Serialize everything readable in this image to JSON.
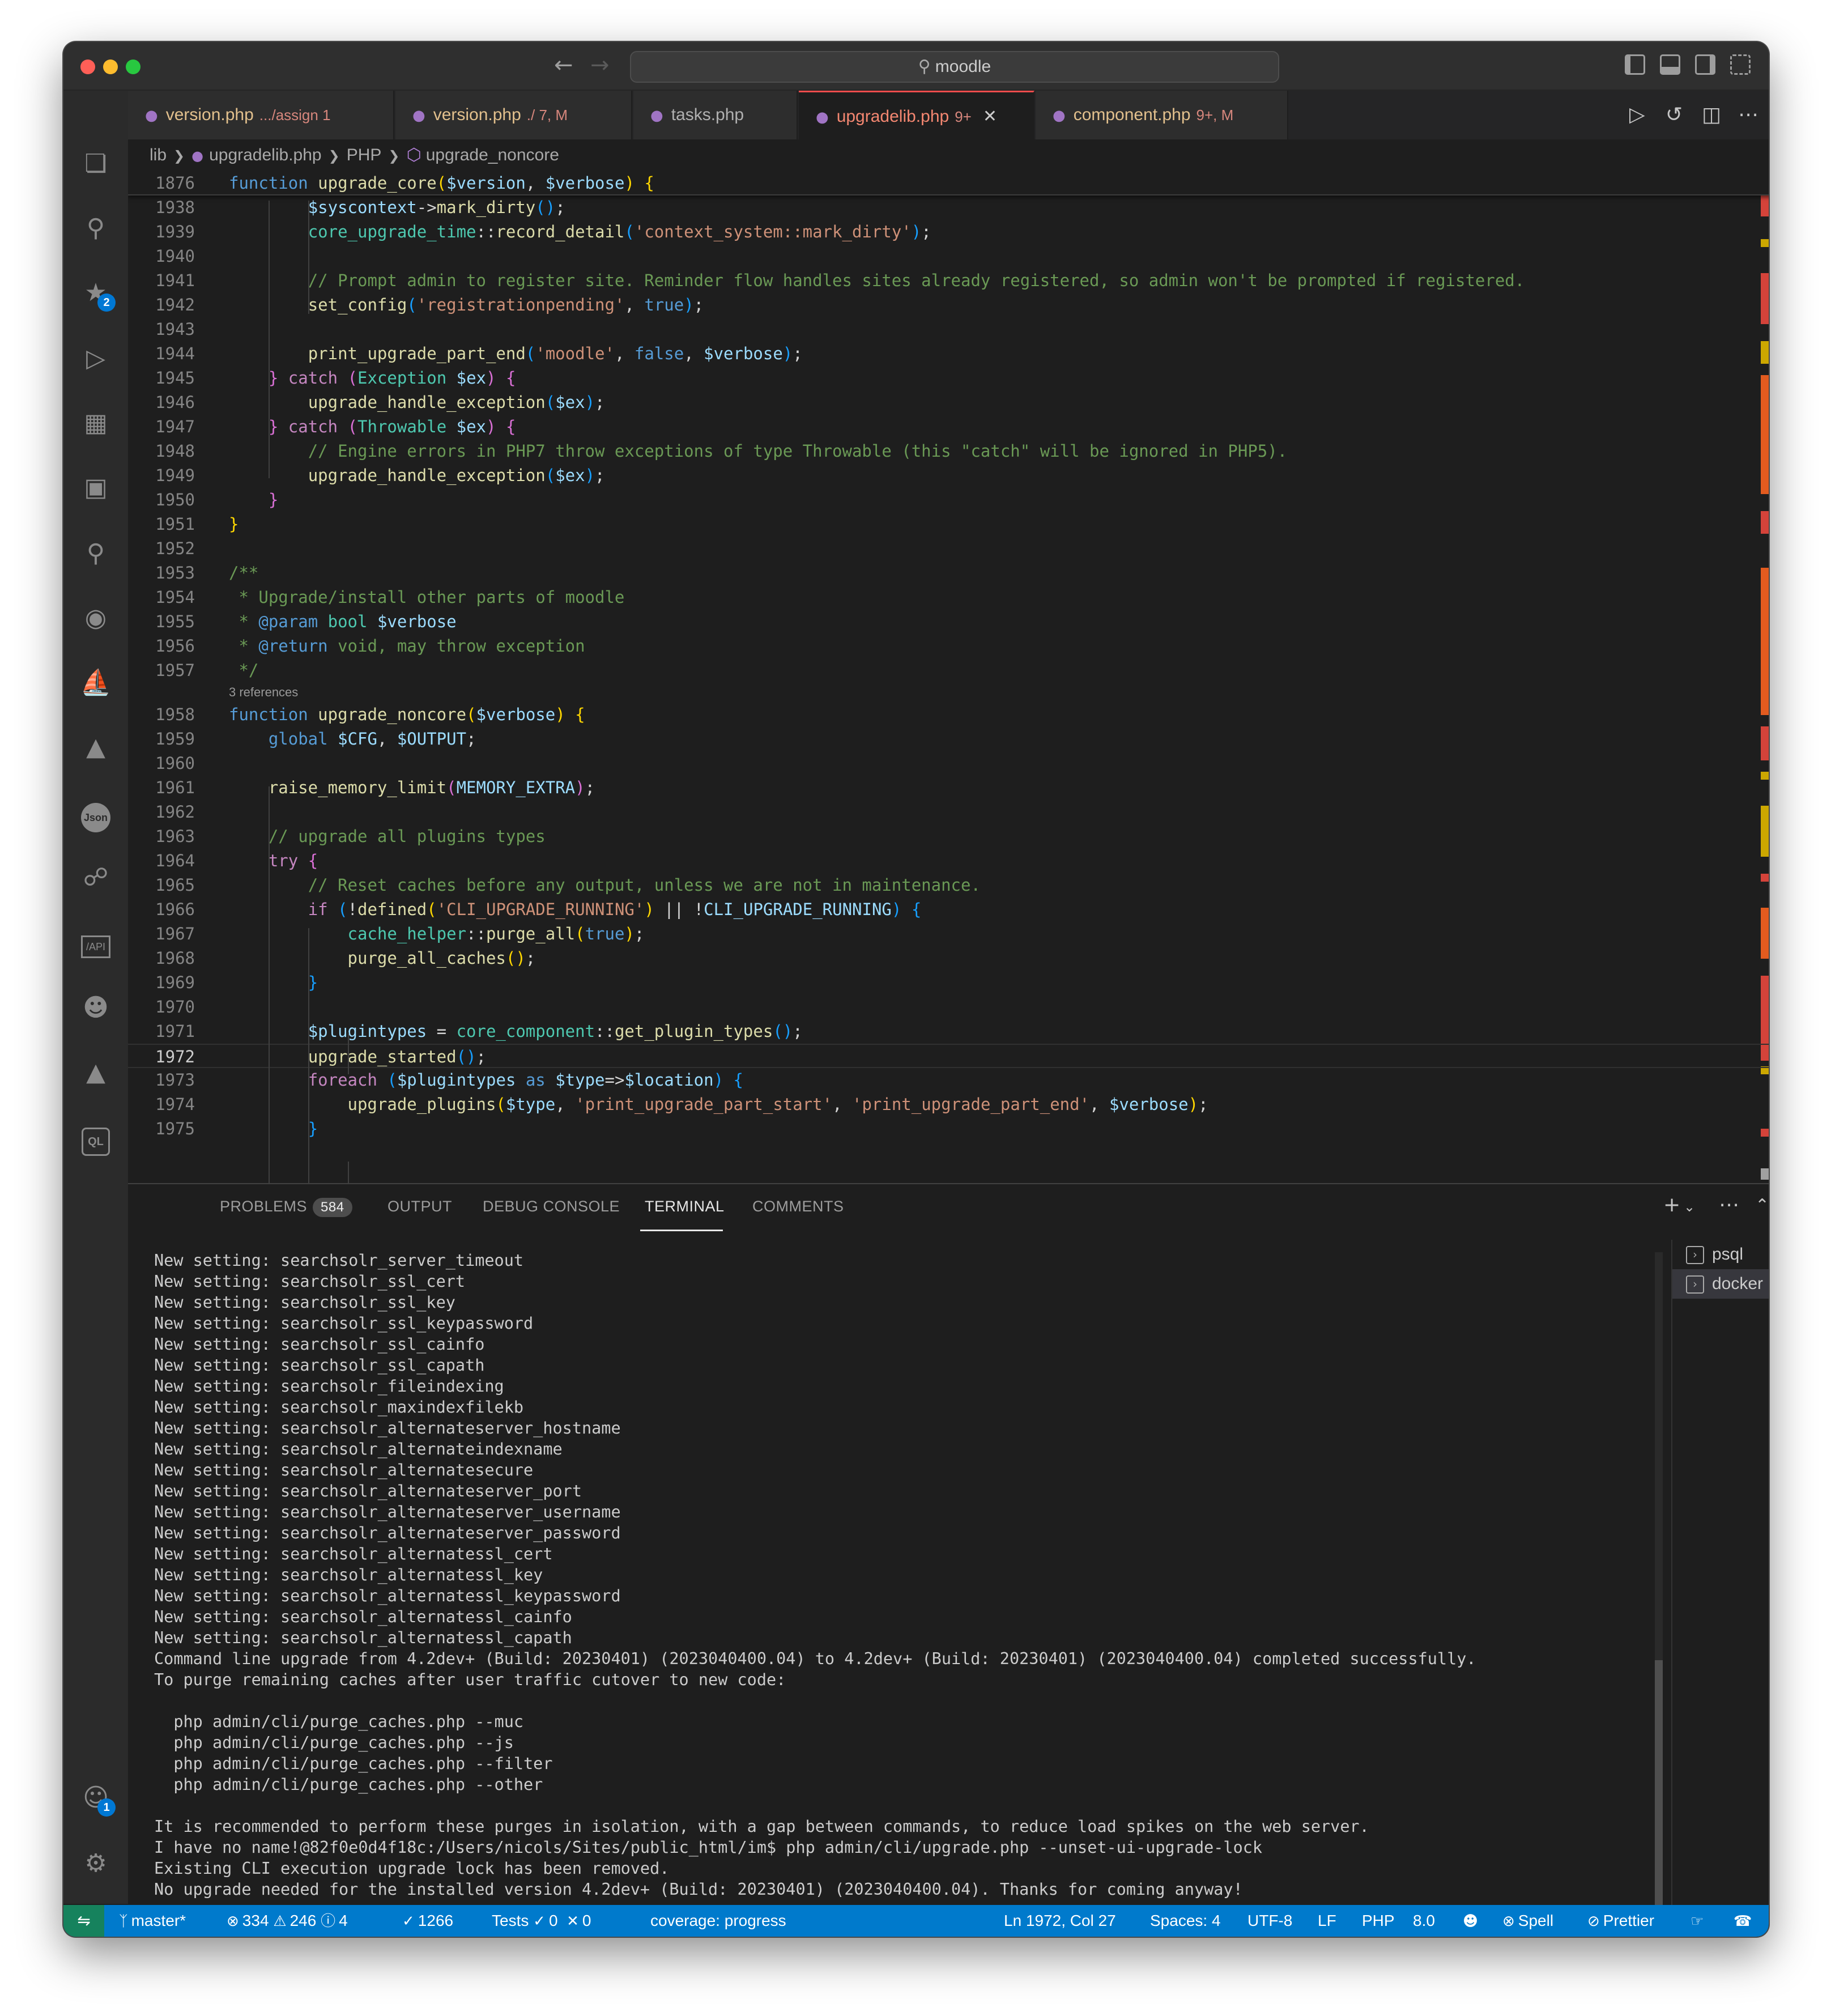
{
  "window": {
    "search_text": "moodle",
    "back_icon": "arrow-left-icon",
    "forward_icon": "arrow-right-icon"
  },
  "activity_bar": {
    "scm_badge": "2",
    "accounts_badge": "1",
    "icons": [
      "explorer-icon",
      "search-icon",
      "source-control-icon",
      "run-debug-icon",
      "extensions-icon",
      "remote-explorer-icon",
      "testing-icon",
      "github-icon",
      "docker-icon",
      "tree-icon",
      "json-icon",
      "database-icon",
      "api-icon",
      "copilot-icon",
      "azure-icon",
      "sql-icon",
      "accounts-icon",
      "settings-icon"
    ],
    "json_label": "Json",
    "api_label": "/API",
    "ql_label": "QL"
  },
  "tabs": [
    {
      "name": "version.php",
      "desc": ".../assign 1",
      "active": false,
      "modified": true
    },
    {
      "name": "version.php",
      "desc": "./ 7, M",
      "active": false,
      "modified": true
    },
    {
      "name": "tasks.php",
      "desc": "",
      "active": false,
      "modified": false
    },
    {
      "name": "upgradelib.php",
      "desc": "9+",
      "active": true,
      "modified": true
    },
    {
      "name": "component.php",
      "desc": "9+, M",
      "active": false,
      "modified": true
    }
  ],
  "breadcrumb": {
    "folder": "lib",
    "file": "upgradelib.php",
    "lang": "PHP",
    "symbol": "upgrade_noncore"
  },
  "editor": {
    "references_label": "3 references",
    "current_line": "1972",
    "lines": [
      {
        "n": "1876",
        "html": "<span class='k'>function</span> <span class='f'>upgrade_core</span><span class='b1'>(</span><span class='v'>$version</span><span class='p'>, </span><span class='v'>$verbose</span><span class='b1'>)</span> <span class='b1'>{</span>"
      },
      {
        "n": "1938",
        "html": "        <span class='v'>$syscontext</span><span class='p'>-></span><span class='f'>mark_dirty</span><span class='b3'>()</span><span class='p'>;</span>"
      },
      {
        "n": "1939",
        "html": "        <span class='t'>core_upgrade_time</span><span class='p'>::</span><span class='f'>record_detail</span><span class='b3'>(</span><span class='s'>'context_system::mark_dirty'</span><span class='b3'>)</span><span class='p'>;</span>"
      },
      {
        "n": "1940",
        "html": ""
      },
      {
        "n": "1941",
        "html": "        <span class='cm'>// Prompt admin to register site. Reminder flow handles sites already registered, so admin won't be prompted if registered.</span>"
      },
      {
        "n": "1942",
        "html": "        <span class='f'>set_config</span><span class='b3'>(</span><span class='s'>'registrationpending'</span><span class='p'>, </span><span class='k'>true</span><span class='b3'>)</span><span class='p'>;</span>"
      },
      {
        "n": "1943",
        "html": ""
      },
      {
        "n": "1944",
        "html": "        <span class='f'>print_upgrade_part_end</span><span class='b3'>(</span><span class='s'>'moodle'</span><span class='p'>, </span><span class='k'>false</span><span class='p'>, </span><span class='v'>$verbose</span><span class='b3'>)</span><span class='p'>;</span>"
      },
      {
        "n": "1945",
        "html": "    <span class='b2'>}</span> <span class='c'>catch</span> <span class='b2'>(</span><span class='t'>Exception</span> <span class='v'>$ex</span><span class='b2'>)</span> <span class='b2'>{</span>"
      },
      {
        "n": "1946",
        "html": "        <span class='f'>upgrade_handle_exception</span><span class='b3'>(</span><span class='v'>$ex</span><span class='b3'>)</span><span class='p'>;</span>"
      },
      {
        "n": "1947",
        "html": "    <span class='b2'>}</span> <span class='c'>catch</span> <span class='b2'>(</span><span class='t'>Throwable</span> <span class='v'>$ex</span><span class='b2'>)</span> <span class='b2'>{</span>"
      },
      {
        "n": "1948",
        "html": "        <span class='cm'>// Engine errors in PHP7 throw exceptions of type Throwable (this \"catch\" will be ignored in PHP5).</span>"
      },
      {
        "n": "1949",
        "html": "        <span class='f'>upgrade_handle_exception</span><span class='b3'>(</span><span class='v'>$ex</span><span class='b3'>)</span><span class='p'>;</span>"
      },
      {
        "n": "1950",
        "html": "    <span class='b2'>}</span>"
      },
      {
        "n": "1951",
        "html": "<span class='b1'>}</span>"
      },
      {
        "n": "1952",
        "html": ""
      },
      {
        "n": "1953",
        "html": "<span class='cm'>/**</span>"
      },
      {
        "n": "1954",
        "html": "<span class='cm'> * Upgrade/install other parts of moodle</span>"
      },
      {
        "n": "1955",
        "html": "<span class='cm'> * </span><span class='k'>@param</span> <span class='t'>bool</span> <span class='v'>$verbose</span>"
      },
      {
        "n": "1956",
        "html": "<span class='cm'> * </span><span class='k'>@return</span><span class='cm'> void, may throw exception</span>"
      },
      {
        "n": "1957",
        "html": "<span class='cm'> */</span>"
      },
      {
        "n": "1958",
        "html": "<span class='k'>function</span> <span class='f'>upgrade_noncore</span><span class='b1'>(</span><span class='v'>$verbose</span><span class='b1'>)</span> <span class='b1'>{</span>"
      },
      {
        "n": "1959",
        "html": "    <span class='k'>global</span> <span class='v'>$CFG</span><span class='p'>, </span><span class='v'>$OUTPUT</span><span class='p'>;</span>"
      },
      {
        "n": "1960",
        "html": ""
      },
      {
        "n": "1961",
        "html": "    <span class='f'>raise_memory_limit</span><span class='b2'>(</span><span class='v'>MEMORY_EXTRA</span><span class='b2'>)</span><span class='p'>;</span>"
      },
      {
        "n": "1962",
        "html": ""
      },
      {
        "n": "1963",
        "html": "    <span class='cm'>// upgrade all plugins types</span>"
      },
      {
        "n": "1964",
        "html": "    <span class='c'>try</span> <span class='b2'>{</span>"
      },
      {
        "n": "1965",
        "html": "        <span class='cm'>// Reset caches before any output, unless we are not in maintenance.</span>"
      },
      {
        "n": "1966",
        "html": "        <span class='c'>if</span> <span class='b3'>(</span><span class='p'>!</span><span class='f'>defined</span><span class='b1'>(</span><span class='s'>'CLI_UPGRADE_RUNNING'</span><span class='b1'>)</span> <span class='p'>|| !</span><span class='v'>CLI_UPGRADE_RUNNING</span><span class='b3'>)</span> <span class='b3'>{</span>"
      },
      {
        "n": "1967",
        "html": "            <span class='t'>cache_helper</span><span class='p'>::</span><span class='f'>purge_all</span><span class='b1'>(</span><span class='k'>true</span><span class='b1'>)</span><span class='p'>;</span>"
      },
      {
        "n": "1968",
        "html": "            <span class='f'>purge_all_caches</span><span class='b1'>()</span><span class='p'>;</span>"
      },
      {
        "n": "1969",
        "html": "        <span class='b3'>}</span>"
      },
      {
        "n": "1970",
        "html": ""
      },
      {
        "n": "1971",
        "html": "        <span class='v'>$plugintypes</span> <span class='p'>= </span><span class='t'>core_component</span><span class='p'>::</span><span class='f'>get_plugin_types</span><span class='b3'>()</span><span class='p'>;</span>"
      },
      {
        "n": "1972",
        "html": "        <span class='f'>upgrade_started</span><span class='b3'>()</span><span class='p'>;</span>"
      },
      {
        "n": "1973",
        "html": "        <span class='c'>foreach</span> <span class='b3'>(</span><span class='v'>$plugintypes</span> <span class='k'>as</span> <span class='v'>$type</span><span class='p'>=></span><span class='v'>$location</span><span class='b3'>)</span> <span class='b3'>{</span>"
      },
      {
        "n": "1974",
        "html": "            <span class='f'>upgrade_plugins</span><span class='b1'>(</span><span class='v'>$type</span><span class='p'>, </span><span class='s'>'print_upgrade_part_start'</span><span class='p'>, </span><span class='s'>'print_upgrade_part_end'</span><span class='p'>, </span><span class='v'>$verbose</span><span class='b1'>)</span><span class='p'>;</span>"
      },
      {
        "n": "1975",
        "html": "        <span class='b3'>}</span>"
      }
    ]
  },
  "panel": {
    "tabs": [
      {
        "label": "PROBLEMS",
        "badge": "584"
      },
      {
        "label": "OUTPUT"
      },
      {
        "label": "DEBUG CONSOLE"
      },
      {
        "label": "TERMINAL",
        "active": true
      },
      {
        "label": "COMMENTS"
      }
    ],
    "terminal_lines": [
      "New setting: searchsolr_server_timeout",
      "New setting: searchsolr_ssl_cert",
      "New setting: searchsolr_ssl_key",
      "New setting: searchsolr_ssl_keypassword",
      "New setting: searchsolr_ssl_cainfo",
      "New setting: searchsolr_ssl_capath",
      "New setting: searchsolr_fileindexing",
      "New setting: searchsolr_maxindexfilekb",
      "New setting: searchsolr_alternateserver_hostname",
      "New setting: searchsolr_alternateindexname",
      "New setting: searchsolr_alternatesecure",
      "New setting: searchsolr_alternateserver_port",
      "New setting: searchsolr_alternateserver_username",
      "New setting: searchsolr_alternateserver_password",
      "New setting: searchsolr_alternatessl_cert",
      "New setting: searchsolr_alternatessl_key",
      "New setting: searchsolr_alternatessl_keypassword",
      "New setting: searchsolr_alternatessl_cainfo",
      "New setting: searchsolr_alternatessl_capath",
      "Command line upgrade from 4.2dev+ (Build: 20230401) (2023040400.04) to 4.2dev+ (Build: 20230401) (2023040400.04) completed successfully.",
      "To purge remaining caches after user traffic cutover to new code:",
      "",
      "  php admin/cli/purge_caches.php --muc",
      "  php admin/cli/purge_caches.php --js",
      "  php admin/cli/purge_caches.php --filter",
      "  php admin/cli/purge_caches.php --other",
      "",
      "It is recommended to perform these purges in isolation, with a gap between commands, to reduce load spikes on the web server.",
      "I have no name!@82f0e0d4f18c:/Users/nicols/Sites/public_html/im$ php admin/cli/upgrade.php --unset-ui-upgrade-lock",
      "Existing CLI execution upgrade lock has been removed.",
      "No upgrade needed for the installed version 4.2dev+ (Build: 20230401) (2023040400.04). Thanks for coming anyway!",
      ""
    ],
    "prompt": "I have no name!@82f0e0d4f18c:/Users/nicols/Sites/public_html/im$ ",
    "terminals": [
      {
        "name": "psql",
        "selected": false
      },
      {
        "name": "docker",
        "selected": true
      }
    ]
  },
  "statusbar": {
    "branch": "master*",
    "errors": "334",
    "warnings": "246",
    "infos": "4",
    "tests_passed": "1266",
    "tests_label": "Tests",
    "tests_ok": "0",
    "tests_fail": "0",
    "coverage": "coverage: progress",
    "position": "Ln 1972, Col 27",
    "spaces": "Spaces: 4",
    "encoding": "UTF-8",
    "eol": "LF",
    "language": "PHP",
    "php_version": "8.0",
    "spell": "Spell",
    "prettier": "Prettier"
  },
  "colors": {
    "status_bar": "#007acc",
    "remote_indicator": "#16825d",
    "active_tab_border": "#f14c4c",
    "badge": "#0078d4"
  }
}
